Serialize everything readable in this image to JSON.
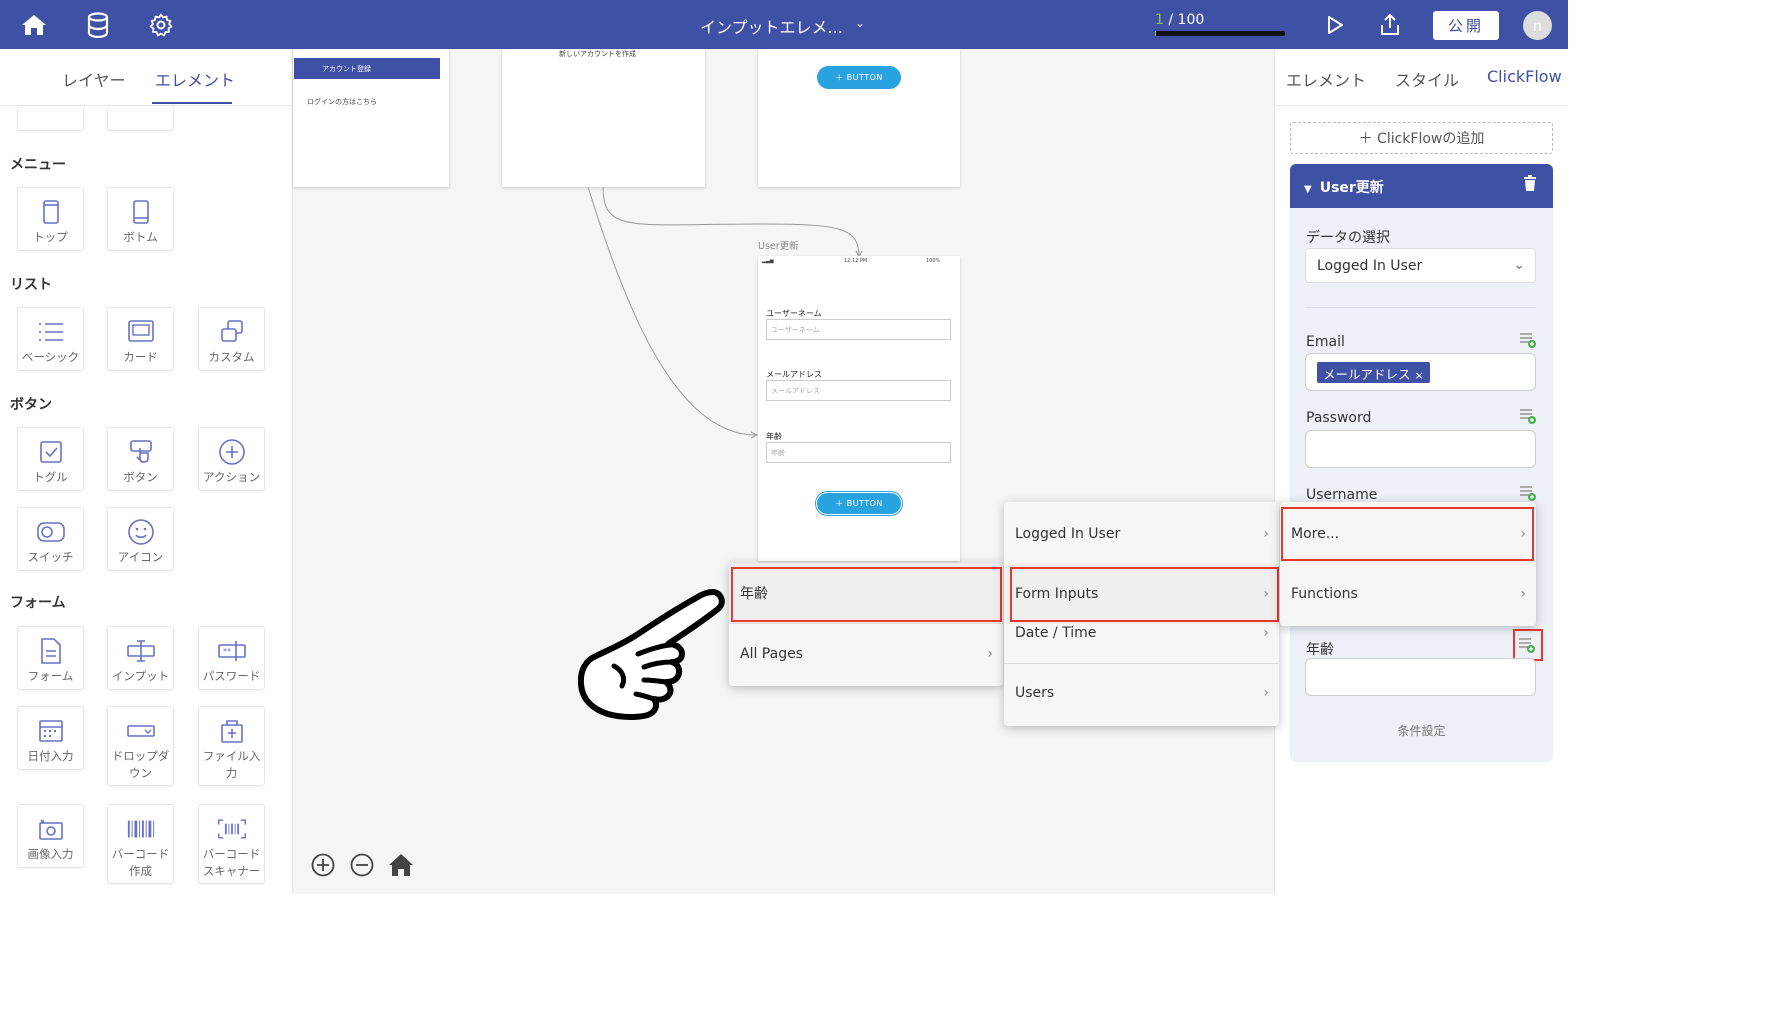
{
  "header": {
    "title": "インプットエレメ...",
    "counter_used": "1",
    "counter_total": " / 100",
    "publish_label": "公開",
    "avatar_initial": "n",
    "quota_fraction": 0.01
  },
  "left_panel": {
    "tabs": [
      "レイヤー",
      "エレメント"
    ],
    "active_tab": "エレメント",
    "sections": {
      "menu": "メニュー",
      "list": "リスト",
      "button": "ボタン",
      "form": "フォーム"
    },
    "tiles": {
      "top": "トップ",
      "bottom": "ボトム",
      "basic": "ベーシック",
      "card": "カード",
      "custom": "カスタム",
      "toggle": "トグル",
      "button": "ボタン",
      "action": "アクション",
      "switch": "スイッチ",
      "icon": "アイコン",
      "form": "フォーム",
      "input": "インプット",
      "password": "パスワード",
      "date": "日付入力",
      "dropdown": "ドロップダウン",
      "file": "ファイル入力",
      "image": "画像入力",
      "barcode_make": "バーコード作成",
      "barcode_scan": "バーコードスキャナー"
    }
  },
  "canvas": {
    "frame1": {
      "button_label": "アカウント登録",
      "link": "ログインの方はこちら"
    },
    "frame2": {
      "text": "新しいアカウントを作成"
    },
    "frame3": {
      "button_label": "＋ BUTTON"
    },
    "user_frame": {
      "page_label": "User更新",
      "time": "12:12 PM",
      "battery": "100%",
      "username_label": "ユーザーネーム",
      "username_placeholder": "ユーザーネーム",
      "email_label": "メールアドレス",
      "email_placeholder": "メールアドレス",
      "age_label": "年齢",
      "age_placeholder": "年齢",
      "button_label": "＋ BUTTON"
    }
  },
  "right_panel": {
    "tabs": [
      "エレメント",
      "スタイル",
      "ClickFlow"
    ],
    "active_tab": "ClickFlow",
    "add_flow": "＋ ClickFlowの追加",
    "flow_title": "User更新",
    "data_select_label": "データの選択",
    "data_select_value": "Logged In User",
    "email_label": "Email",
    "email_chip": "メールアドレス",
    "password_label": "Password",
    "username_label": "Username",
    "age_label": "年齢",
    "condition": "条件設定"
  },
  "menus": {
    "menu1": [
      "年齢",
      "All Pages"
    ],
    "menu2": [
      "Logged In User",
      "Form Inputs",
      "Date / Time",
      "Users"
    ],
    "menu3": [
      "More...",
      "Functions"
    ]
  },
  "colors": {
    "primary": "#3f51a5",
    "accent_blue": "#29a3e0",
    "highlight_red": "#e53935",
    "plus_green": "#4caf50"
  }
}
